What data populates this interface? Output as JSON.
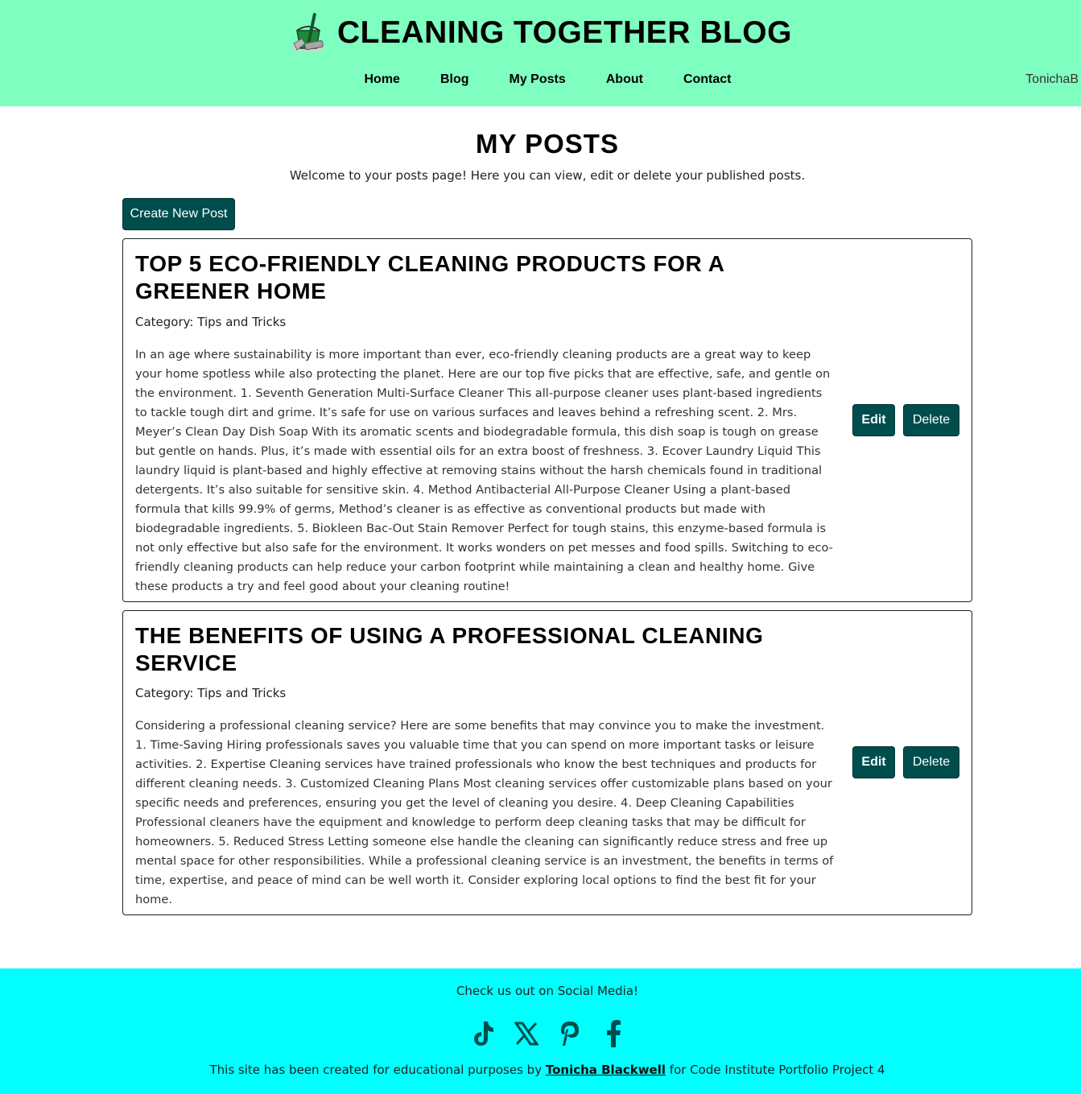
{
  "header": {
    "title": "CLEANING TOGETHER BLOG",
    "logo_icon": "cleaning-bucket-logo-icon",
    "nav": [
      {
        "label": "Home"
      },
      {
        "label": "Blog"
      },
      {
        "label": "My Posts"
      },
      {
        "label": "About"
      },
      {
        "label": "Contact"
      }
    ],
    "username": "TonichaB",
    "bg_color": "#7fffbf"
  },
  "main": {
    "page_title": "MY POSTS",
    "welcome": "Welcome to your posts page! Here you can view, edit or delete your published posts.",
    "create_button": "Create New Post",
    "posts": [
      {
        "title": "Top 5 Eco-Friendly Cleaning Products for a Greener Home",
        "category": "Category: Tips and Tricks",
        "body": "In an age where sustainability is more important than ever, eco-friendly cleaning products are a great way to keep your home spotless while also protecting the planet. Here are our top five picks that are effective, safe, and gentle on the environment. 1. Seventh Generation Multi-Surface Cleaner This all-purpose cleaner uses plant-based ingredients to tackle tough dirt and grime. It’s safe for use on various surfaces and leaves behind a refreshing scent. 2. Mrs. Meyer’s Clean Day Dish Soap With its aromatic scents and biodegradable formula, this dish soap is tough on grease but gentle on hands. Plus, it’s made with essential oils for an extra boost of freshness. 3. Ecover Laundry Liquid This laundry liquid is plant-based and highly effective at removing stains without the harsh chemicals found in traditional detergents. It’s also suitable for sensitive skin. 4. Method Antibacterial All-Purpose Cleaner Using a plant-based formula that kills 99.9% of germs, Method’s cleaner is as effective as conventional products but made with biodegradable ingredients. 5. Biokleen Bac-Out Stain Remover Perfect for tough stains, this enzyme-based formula is not only effective but also safe for the environment. It works wonders on pet messes and food spills. Switching to eco-friendly cleaning products can help reduce your carbon footprint while maintaining a clean and healthy home. Give these products a try and feel good about your cleaning routine!",
        "edit_label": "Edit",
        "delete_label": "Delete"
      },
      {
        "title": "The Benefits of Using a Professional Cleaning Service",
        "category": "Category: Tips and Tricks",
        "body": "Considering a professional cleaning service? Here are some benefits that may convince you to make the investment. 1. Time-Saving Hiring professionals saves you valuable time that you can spend on more important tasks or leisure activities. 2. Expertise Cleaning services have trained professionals who know the best techniques and products for different cleaning needs. 3. Customized Cleaning Plans Most cleaning services offer customizable plans based on your specific needs and preferences, ensuring you get the level of cleaning you desire. 4. Deep Cleaning Capabilities Professional cleaners have the equipment and knowledge to perform deep cleaning tasks that may be difficult for homeowners. 5. Reduced Stress Letting someone else handle the cleaning can significantly reduce stress and free up mental space for other responsibilities. While a professional cleaning service is an investment, the benefits in terms of time, expertise, and peace of mind can be well worth it. Consider exploring local options to find the best fit for your home.",
        "edit_label": "Edit",
        "delete_label": "Delete"
      }
    ],
    "button_color": "#004d4d"
  },
  "footer": {
    "social_heading": "Check us out on Social Media!",
    "social_icons": [
      "tiktok-icon",
      "x-twitter-icon",
      "pinterest-icon",
      "facebook-icon"
    ],
    "credit_prefix": "This site has been created for educational purposes by ",
    "credit_link": "Tonicha Blackwell",
    "credit_suffix": " for Code Institute Portfolio Project 4",
    "bg_color": "#00ffff"
  }
}
